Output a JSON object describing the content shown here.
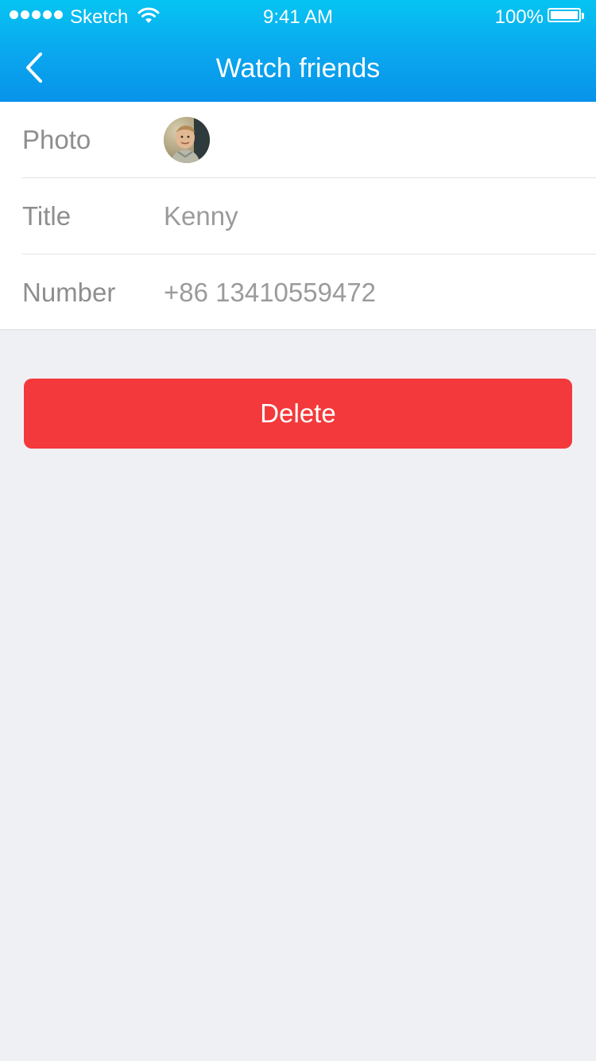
{
  "status_bar": {
    "carrier": "Sketch",
    "time": "9:41 AM",
    "battery": "100%",
    "signal_icon": "signal-dots-icon",
    "wifi_icon": "wifi-icon",
    "battery_icon": "battery-icon"
  },
  "nav": {
    "title": "Watch friends",
    "back_icon": "chevron-left-icon"
  },
  "form": {
    "rows": [
      {
        "label": "Photo",
        "value": ""
      },
      {
        "label": "Title",
        "value": "Kenny"
      },
      {
        "label": "Number",
        "value": "+86 13410559472"
      }
    ]
  },
  "actions": {
    "delete_label": "Delete"
  },
  "colors": {
    "header_gradient_top": "#06c4f2",
    "header_gradient_bottom": "#0793ea",
    "delete": "#f3393b",
    "background": "#eff0f4"
  }
}
